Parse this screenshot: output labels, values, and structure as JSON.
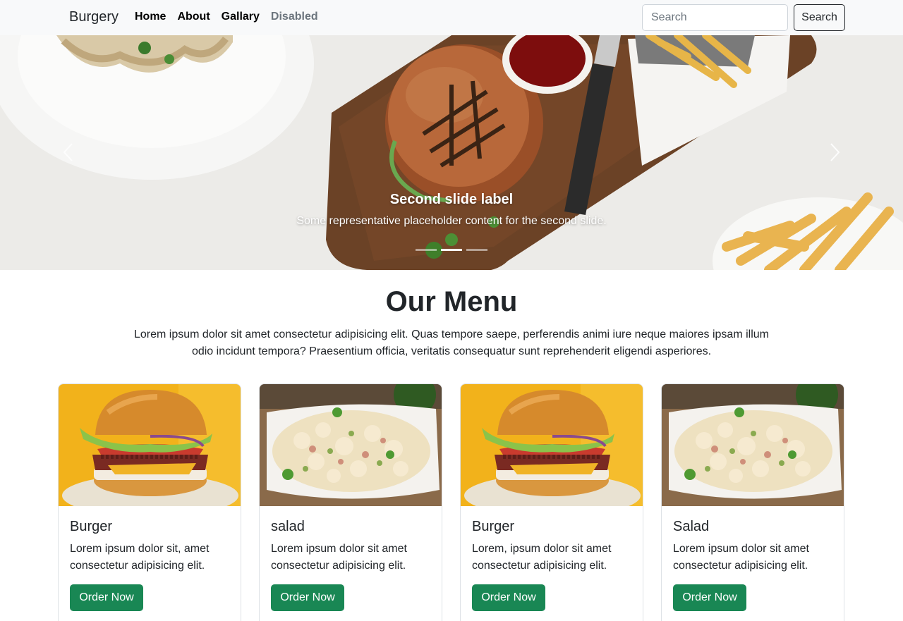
{
  "navbar": {
    "brand": "Burgery",
    "links": [
      {
        "label": "Home",
        "disabled": false
      },
      {
        "label": "About",
        "disabled": false
      },
      {
        "label": "Gallary",
        "disabled": false
      },
      {
        "label": "Disabled",
        "disabled": true
      }
    ],
    "search": {
      "placeholder": "Search",
      "button_label": "Search"
    }
  },
  "carousel": {
    "caption_title": "Second slide label",
    "caption_text": "Some representative placeholder content for the second slide.",
    "active_slide": 2,
    "slide_count": 3
  },
  "menu": {
    "title": "Our Menu",
    "lead": "Lorem ipsum dolor sit amet consectetur adipisicing elit. Quas tempore saepe, perferendis animi iure neque maiores ipsam illum odio incidunt tempora? Praesentium officia, veritatis consequatur sunt reprehenderit eligendi asperiores.",
    "cards": [
      {
        "title": "Burger",
        "text": "Lorem ipsum dolor sit, amet consectetur adipisicing elit.",
        "button": "Order Now",
        "image": "burger-photo"
      },
      {
        "title": "salad",
        "text": "Lorem ipsum dolor sit amet consectetur adipisicing elit.",
        "button": "Order Now",
        "image": "salad-photo"
      },
      {
        "title": "Burger",
        "text": "Lorem, ipsum dolor sit amet consectetur adipisicing elit.",
        "button": "Order Now",
        "image": "burger-photo"
      },
      {
        "title": "Salad",
        "text": "Lorem ipsum dolor sit amet consectetur adipisicing elit.",
        "button": "Order Now",
        "image": "salad-photo"
      }
    ]
  },
  "colors": {
    "navbar_bg": "#f8f9fa",
    "order_button": "#198754",
    "text": "#212529",
    "muted": "#6c757d"
  }
}
